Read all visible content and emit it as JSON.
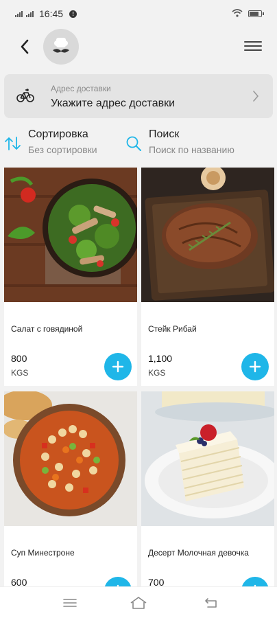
{
  "status_bar": {
    "time": "16:45",
    "icons": [
      "signal-icon",
      "signal-icon",
      "alert-icon",
      "wifi-icon",
      "battery-icon"
    ],
    "battery_level": 0.8
  },
  "header": {
    "back_icon": "chevron-left-icon",
    "avatar_icon": "chef-mustache-icon",
    "menu_icon": "hamburger-menu-icon"
  },
  "address": {
    "label": "Адрес доставки",
    "value": "Укажите адрес доставки",
    "icon": "bicycle-icon",
    "chevron_icon": "chevron-right-icon"
  },
  "tools": {
    "sort": {
      "title": "Сортировка",
      "subtitle": "Без сортировки",
      "icon": "sort-arrows-icon"
    },
    "search": {
      "title": "Поиск",
      "subtitle": "Поиск по названию",
      "icon": "search-icon"
    }
  },
  "products": [
    {
      "name": "Салат с говядиной",
      "price": "800",
      "currency": "KGS",
      "photo": "beef-salad-photo"
    },
    {
      "name": "Стейк Рибай",
      "price": "1,100",
      "currency": "KGS",
      "photo": "ribeye-steak-photo"
    },
    {
      "name": "Суп Минестроне",
      "price": "600",
      "currency": "",
      "photo": "minestrone-soup-photo"
    },
    {
      "name": "Десерт Молочная девочка",
      "price": "700",
      "currency": "",
      "photo": "milk-girl-cake-photo"
    }
  ],
  "bottom_nav": {
    "icons": [
      "recent-apps-icon",
      "home-icon",
      "back-icon"
    ]
  },
  "colors": {
    "accent": "#1fb6e8",
    "background": "#f2f2f2",
    "card_background": "#ffffff",
    "address_background": "#e4e4e4"
  }
}
